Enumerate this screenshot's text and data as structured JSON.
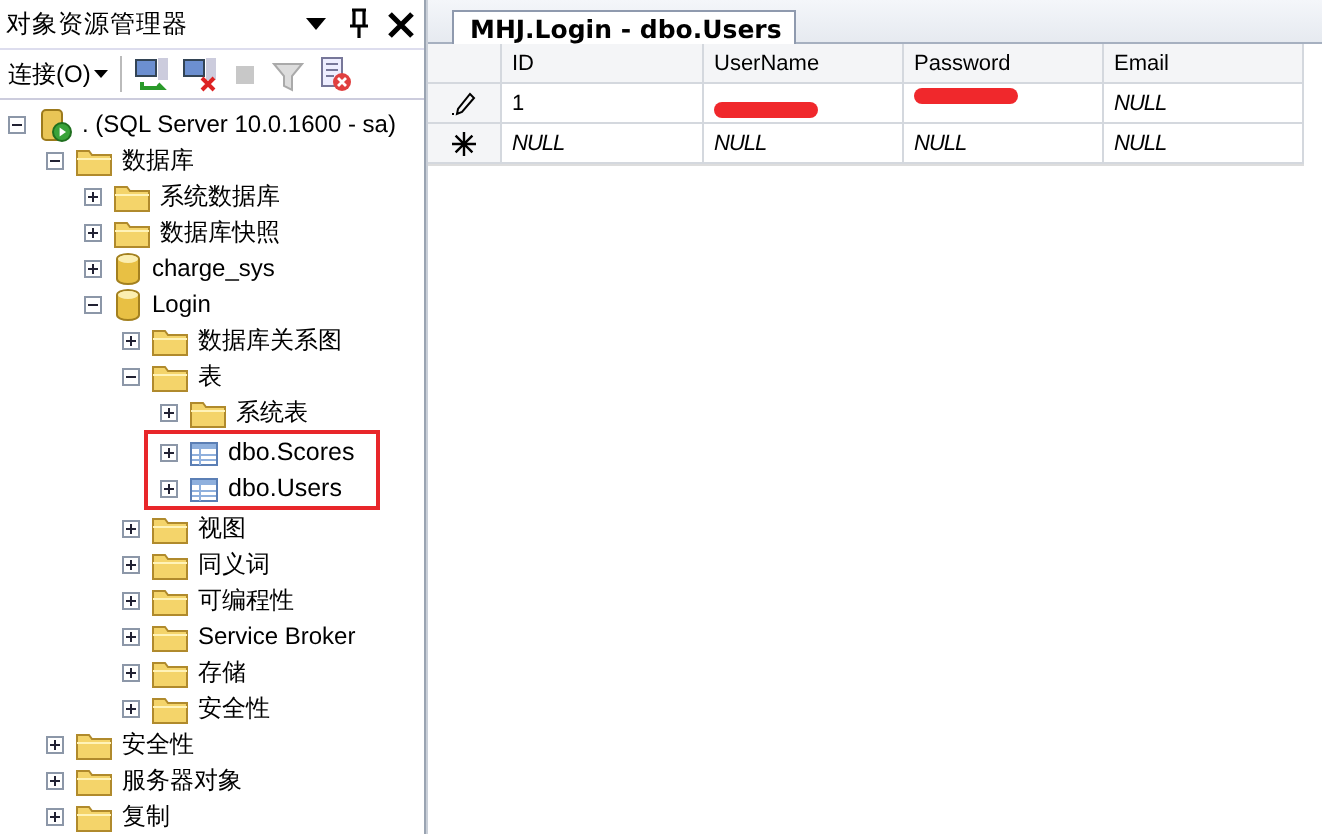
{
  "explorer": {
    "title": "对象资源管理器",
    "connect_label": "连接(O)",
    "tree": [
      {
        "label": ". (SQL Server 10.0.1600 - sa)",
        "kind": "server",
        "expanded": true,
        "children": [
          {
            "label": "数据库",
            "kind": "folder",
            "expanded": true,
            "children": [
              {
                "label": "系统数据库",
                "kind": "folder",
                "expanded": false
              },
              {
                "label": "数据库快照",
                "kind": "folder",
                "expanded": false
              },
              {
                "label": "charge_sys",
                "kind": "database",
                "expanded": false
              },
              {
                "label": "Login",
                "kind": "database",
                "expanded": true,
                "children": [
                  {
                    "label": "数据库关系图",
                    "kind": "folder",
                    "expanded": false
                  },
                  {
                    "label": "表",
                    "kind": "folder",
                    "expanded": true,
                    "children": [
                      {
                        "label": "系统表",
                        "kind": "folder",
                        "expanded": false
                      },
                      {
                        "label": "dbo.Scores",
                        "kind": "table",
                        "expanded": false,
                        "highlighted": true
                      },
                      {
                        "label": "dbo.Users",
                        "kind": "table",
                        "expanded": false,
                        "highlighted": true
                      }
                    ]
                  },
                  {
                    "label": "视图",
                    "kind": "folder",
                    "expanded": false
                  },
                  {
                    "label": "同义词",
                    "kind": "folder",
                    "expanded": false
                  },
                  {
                    "label": "可编程性",
                    "kind": "folder",
                    "expanded": false
                  },
                  {
                    "label": "Service Broker",
                    "kind": "folder",
                    "expanded": false
                  },
                  {
                    "label": "存储",
                    "kind": "folder",
                    "expanded": false
                  },
                  {
                    "label": "安全性",
                    "kind": "folder",
                    "expanded": false
                  }
                ]
              }
            ]
          },
          {
            "label": "安全性",
            "kind": "folder",
            "expanded": false
          },
          {
            "label": "服务器对象",
            "kind": "folder",
            "expanded": false
          },
          {
            "label": "复制",
            "kind": "folder",
            "expanded": false
          }
        ]
      }
    ]
  },
  "document": {
    "tab": "MHJ.Login - dbo.Users",
    "columns": [
      "ID",
      "UserName",
      "Password",
      "Email"
    ],
    "rows": [
      {
        "editing": true,
        "new_row": false,
        "cells": [
          {
            "kind": "text",
            "text": "1"
          },
          {
            "kind": "redacted"
          },
          {
            "kind": "redacted"
          },
          {
            "kind": "null",
            "text": "NULL"
          }
        ]
      },
      {
        "editing": false,
        "new_row": true,
        "cells": [
          {
            "kind": "null",
            "text": "NULL"
          },
          {
            "kind": "null",
            "text": "NULL"
          },
          {
            "kind": "null",
            "text": "NULL"
          },
          {
            "kind": "null",
            "text": "NULL"
          }
        ]
      }
    ]
  }
}
